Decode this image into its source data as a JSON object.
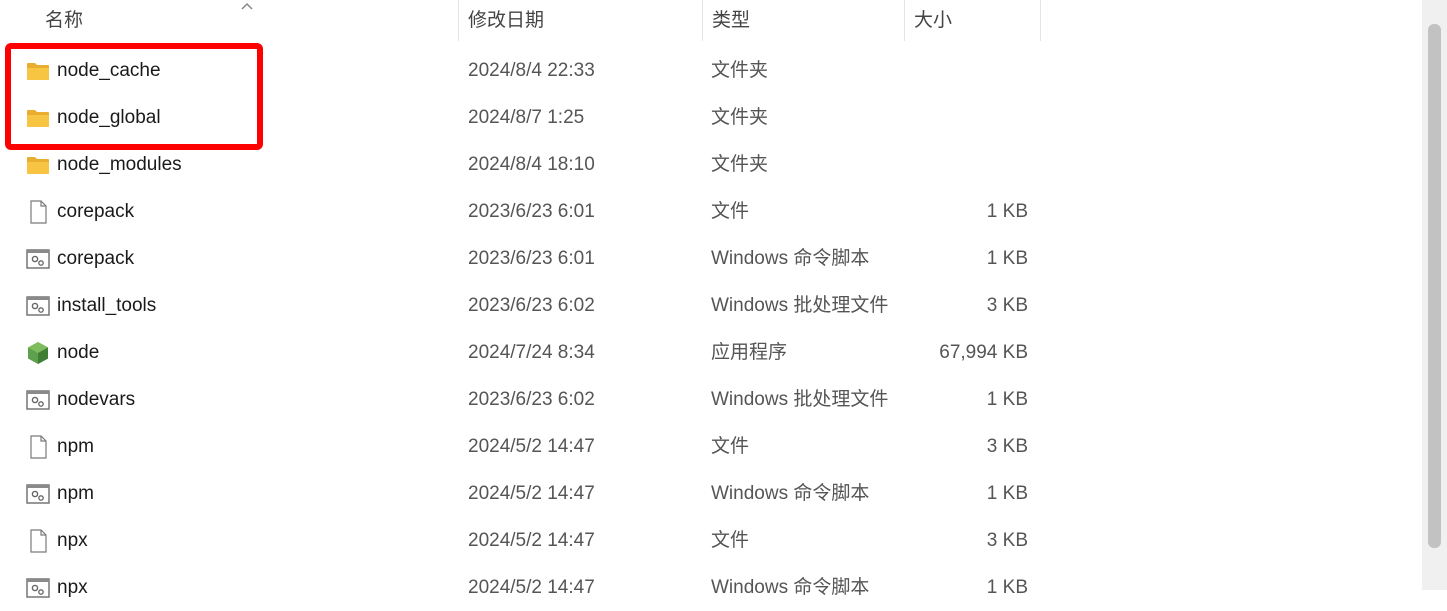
{
  "columns": {
    "name": "名称",
    "date": "修改日期",
    "type": "类型",
    "size": "大小"
  },
  "files": [
    {
      "name": "node_cache",
      "date": "2024/8/4 22:33",
      "type": "文件夹",
      "size": "",
      "icon": "folder-icon"
    },
    {
      "name": "node_global",
      "date": "2024/8/7 1:25",
      "type": "文件夹",
      "size": "",
      "icon": "folder-icon"
    },
    {
      "name": "node_modules",
      "date": "2024/8/4 18:10",
      "type": "文件夹",
      "size": "",
      "icon": "folder-icon"
    },
    {
      "name": "corepack",
      "date": "2023/6/23 6:01",
      "type": "文件",
      "size": "1 KB",
      "icon": "file-icon"
    },
    {
      "name": "corepack",
      "date": "2023/6/23 6:01",
      "type": "Windows 命令脚本",
      "size": "1 KB",
      "icon": "script-icon"
    },
    {
      "name": "install_tools",
      "date": "2023/6/23 6:02",
      "type": "Windows 批处理文件",
      "size": "3 KB",
      "icon": "script-icon"
    },
    {
      "name": "node",
      "date": "2024/7/24 8:34",
      "type": "应用程序",
      "size": "67,994 KB",
      "icon": "nodejs-icon"
    },
    {
      "name": "nodevars",
      "date": "2023/6/23 6:02",
      "type": "Windows 批处理文件",
      "size": "1 KB",
      "icon": "script-icon"
    },
    {
      "name": "npm",
      "date": "2024/5/2 14:47",
      "type": "文件",
      "size": "3 KB",
      "icon": "file-icon"
    },
    {
      "name": "npm",
      "date": "2024/5/2 14:47",
      "type": "Windows 命令脚本",
      "size": "1 KB",
      "icon": "script-icon"
    },
    {
      "name": "npx",
      "date": "2024/5/2 14:47",
      "type": "文件",
      "size": "3 KB",
      "icon": "file-icon"
    },
    {
      "name": "npx",
      "date": "2024/5/2 14:47",
      "type": "Windows 命令脚本",
      "size": "1 KB",
      "icon": "script-icon"
    }
  ],
  "highlight_color": "#ff0000",
  "folder_color": "#f8c542"
}
